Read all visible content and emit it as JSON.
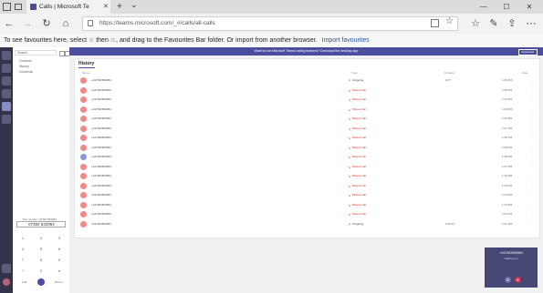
{
  "browser": {
    "tab_title": "Calls | Microsoft Te",
    "url": "https://teams.microsoft.com/_#/calls/all-calls",
    "new_tab_symbol": "+",
    "tabs_dropdown_symbol": "⌄"
  },
  "favourites_bar": {
    "message": "To see favourites here, select ☆ then ☆, and drag to the Favourites Bar folder. Or import from another browser.",
    "import_link": "Import favourites"
  },
  "banner": {
    "text": "Want to use Microsoft Teams calling features? Download the desktop app",
    "button": "Download"
  },
  "dial_panel": {
    "search_placeholder": "Search",
    "nav_items": [
      "Contacts",
      "History",
      "Voicemail"
    ],
    "your_number_label": "Your number: 07392 653964",
    "dial_input": "07392 632964",
    "keys": [
      "1",
      "2",
      "3",
      "4",
      "5",
      "6",
      "7",
      "8",
      "9",
      "*",
      "0",
      "#"
    ],
    "call_label": "Call",
    "phone_label": "Phone"
  },
  "history": {
    "title": "History",
    "columns": [
      "Name",
      "Type",
      "Duration",
      "Date"
    ],
    "rows": [
      {
        "name": "+447392653964",
        "type": "Outgoing",
        "duration": "0:07",
        "date": "1:36 PM",
        "kind": "out",
        "avatar": "#f08a8a"
      },
      {
        "name": "+447392653964",
        "type": "Missed call",
        "duration": "",
        "date": "1:35 PM",
        "kind": "missed",
        "avatar": "#f08a8a"
      },
      {
        "name": "+447392653964",
        "type": "Missed call",
        "duration": "",
        "date": "1:34 PM",
        "kind": "missed",
        "avatar": "#f08a8a"
      },
      {
        "name": "+447392653964",
        "type": "Missed call",
        "duration": "",
        "date": "1:33 PM",
        "kind": "missed",
        "avatar": "#f08a8a"
      },
      {
        "name": "+447392653964",
        "type": "Missed call",
        "duration": "",
        "date": "1:32 PM",
        "kind": "missed",
        "avatar": "#f08a8a"
      },
      {
        "name": "+447392653964",
        "type": "Missed call",
        "duration": "",
        "date": "1:31 PM",
        "kind": "missed",
        "avatar": "#f08a8a"
      },
      {
        "name": "+447392653964",
        "type": "Missed call",
        "duration": "",
        "date": "1:30 PM",
        "kind": "missed",
        "avatar": "#f08a8a"
      },
      {
        "name": "+447392653964",
        "type": "Missed call",
        "duration": "",
        "date": "1:29 PM",
        "kind": "missed",
        "avatar": "#f08a8a"
      },
      {
        "name": "+447392653964",
        "type": "Missed call",
        "duration": "",
        "date": "1:28 PM",
        "kind": "missed",
        "avatar": "#8a97d6"
      },
      {
        "name": "+447392653964",
        "type": "Missed call",
        "duration": "",
        "date": "1:27 PM",
        "kind": "missed",
        "avatar": "#f08a8a"
      },
      {
        "name": "+447392653964",
        "type": "Missed call",
        "duration": "",
        "date": "1:26 PM",
        "kind": "missed",
        "avatar": "#f08a8a"
      },
      {
        "name": "+447392653964",
        "type": "Missed call",
        "duration": "",
        "date": "1:25 PM",
        "kind": "missed",
        "avatar": "#f08a8a"
      },
      {
        "name": "+447392653964",
        "type": "Missed call",
        "duration": "",
        "date": "1:24 PM",
        "kind": "missed",
        "avatar": "#f08a8a"
      },
      {
        "name": "+447392653964",
        "type": "Missed call",
        "duration": "",
        "date": "1:23 PM",
        "kind": "missed",
        "avatar": "#f08a8a"
      },
      {
        "name": "+447392653964",
        "type": "Missed call",
        "duration": "",
        "date": "1:22 PM",
        "kind": "missed",
        "avatar": "#f08a8a"
      },
      {
        "name": "+447392653964",
        "type": "Outgoing",
        "duration": "0:00:24",
        "date": "1:21 PM",
        "kind": "out",
        "avatar": "#f08a8a"
      }
    ]
  },
  "call_popup": {
    "number": "+447392653964",
    "status": "Calling you"
  },
  "colors": {
    "teams_purple": "#4b4e9e",
    "rail": "#33344a",
    "missed": "#d13438",
    "hangup": "#c4314b"
  }
}
